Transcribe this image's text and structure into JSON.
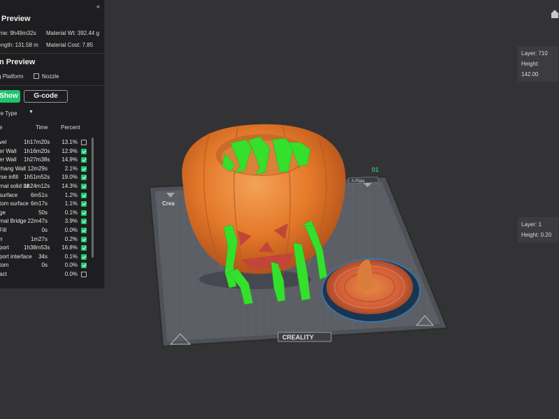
{
  "panel": {
    "collapse_icon": "«",
    "slice_title": "Preview",
    "stats": {
      "time": "ime: 9h49m32s",
      "material_wt": "Material Wt: 392.44 g",
      "length": "ength: 131.58 m",
      "material_cost": "Material Cost: 7.85"
    },
    "view_title": "n Preview",
    "options": [
      {
        "label": "g Platform",
        "checked": false
      },
      {
        "label": "Nozzle",
        "checked": false
      }
    ],
    "show_label": "Show",
    "gcode_label": "G-code",
    "dropdown_label": "re Type",
    "headers": {
      "name": "e",
      "time": "Time",
      "percent": "Percent"
    },
    "rows": [
      {
        "name": "vel",
        "time": "1h17m20s",
        "pct": "13.1%",
        "checked": false
      },
      {
        "name": "er Wall",
        "time": "1h16m20s",
        "pct": "12.9%",
        "checked": true
      },
      {
        "name": "er Wall",
        "time": "1h27m38s",
        "pct": "14.9%",
        "checked": true
      },
      {
        "name": "rhang Wall",
        "time": "12m29s",
        "pct": "2.1%",
        "checked": true
      },
      {
        "name": "rse infill",
        "time": "1h51m52s",
        "pct": "19.0%",
        "checked": true
      },
      {
        "name": "rnal solid inf",
        "time": "1h24m12s",
        "pct": "14.3%",
        "checked": true
      },
      {
        "name": "surface",
        "time": "6m51s",
        "pct": "1.2%",
        "checked": true
      },
      {
        "name": "tom surface",
        "time": "6m17s",
        "pct": "1.1%",
        "checked": true
      },
      {
        "name": "ge",
        "time": "50s",
        "pct": "0.1%",
        "checked": true
      },
      {
        "name": "rnal Bridge",
        "time": "22m47s",
        "pct": "3.9%",
        "checked": true
      },
      {
        "name": "Fill",
        "time": "0s",
        "pct": "0.0%",
        "checked": true
      },
      {
        "name": "n",
        "time": "1m27s",
        "pct": "0.2%",
        "checked": true
      },
      {
        "name": "port",
        "time": "1h38m53s",
        "pct": "16.8%",
        "checked": true
      },
      {
        "name": "port interface",
        "time": "34s",
        "pct": "0.1%",
        "checked": true
      },
      {
        "name": "tom",
        "time": "0s",
        "pct": "0.0%",
        "checked": true
      },
      {
        "name": "act",
        "time": "",
        "pct": "0.0%",
        "checked": false
      }
    ]
  },
  "viewport": {
    "plate_number": "01",
    "plate_tab": "A Plate",
    "bed_brand_left": "Crea",
    "bed_brand_bottom": "CREALITY",
    "top_layer": {
      "layer": "Layer: 710",
      "height": "Height: 142.00"
    },
    "bottom_layer": {
      "layer": "Layer: 1",
      "height": "Height: 0.20"
    },
    "home_icon": "home-icon"
  },
  "colors": {
    "accent_green": "#1fc46e",
    "pumpkin": "#e37624",
    "support": "#35e02d",
    "bed": "#565a60",
    "plate_tab": "#2fb86f"
  }
}
